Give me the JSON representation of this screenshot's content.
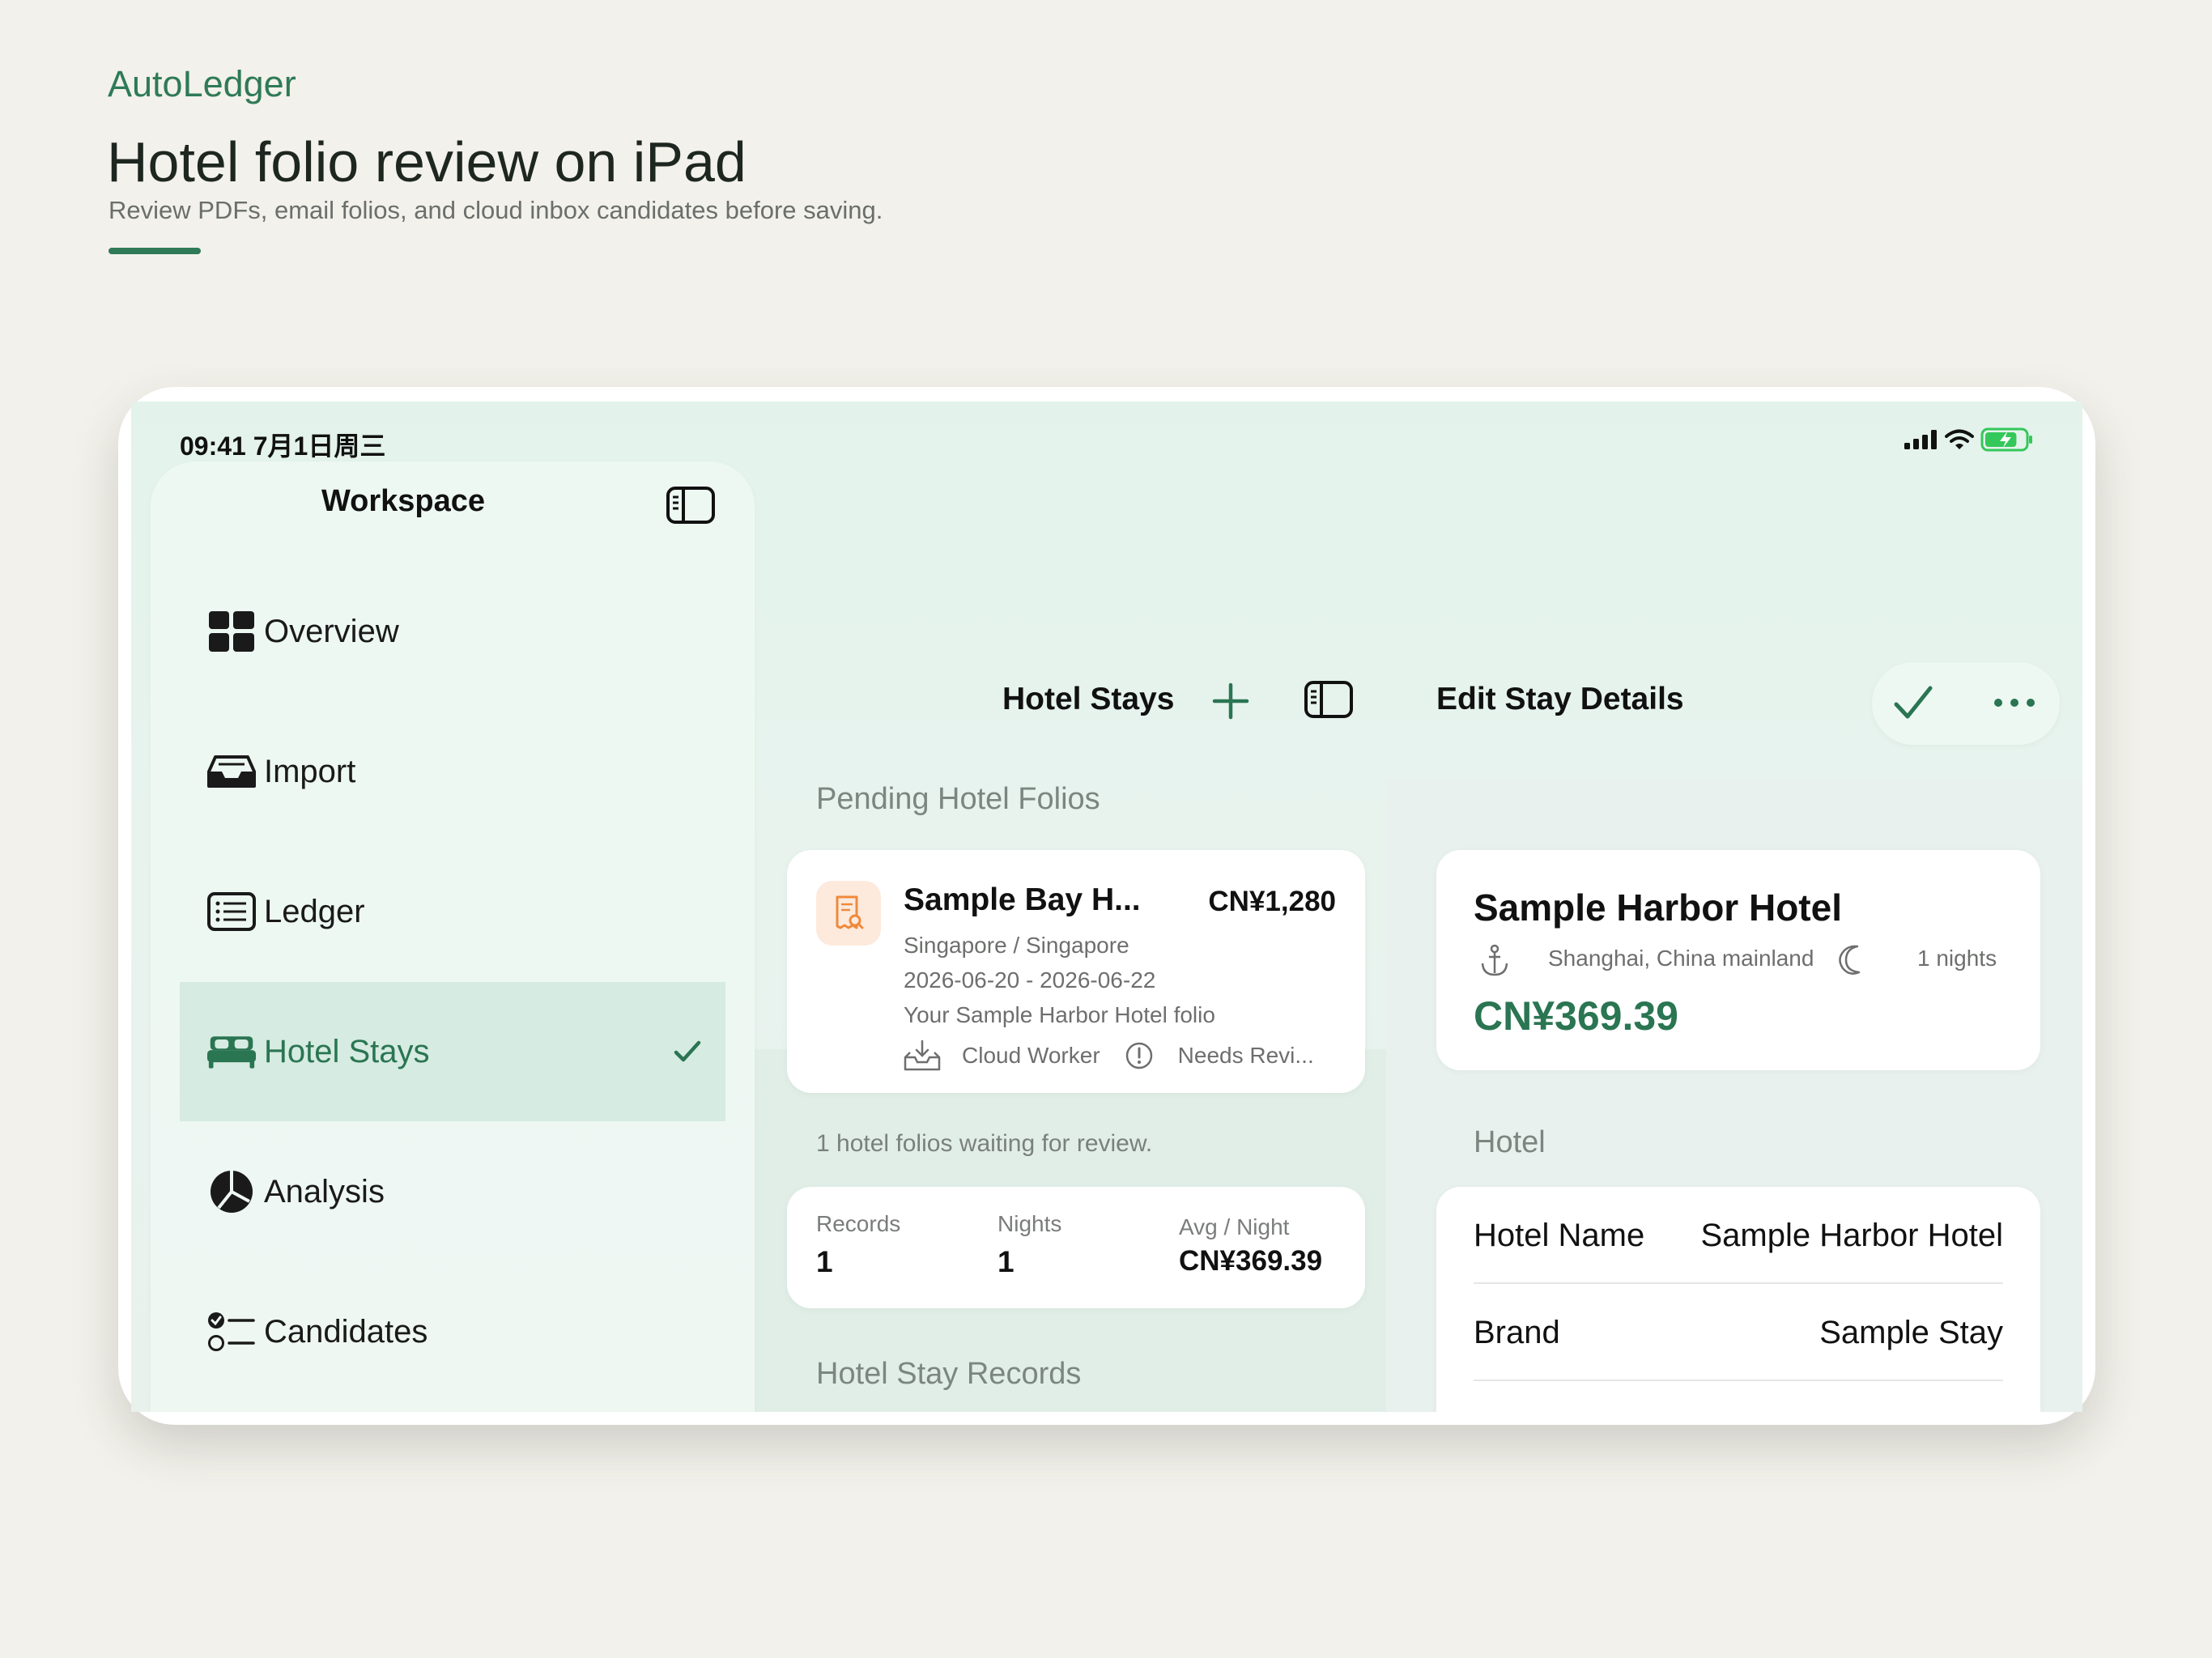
{
  "page": {
    "brand": "AutoLedger",
    "headline": "Hotel folio review on iPad",
    "subline": "Review PDFs, email folios, and cloud inbox candidates before saving."
  },
  "status_bar": {
    "time": "09:41  7月1日周三",
    "battery_level": 0.8
  },
  "colors": {
    "accent": "#2f7a57",
    "active_bg": "#d6ebe1",
    "folio_icon_bg": "#fdeadc",
    "folio_icon": "#ef8a3c"
  },
  "sidebar": {
    "title": "Workspace",
    "items": [
      {
        "label": "Overview",
        "icon": "grid-icon"
      },
      {
        "label": "Import",
        "icon": "inbox-tray-icon"
      },
      {
        "label": "Ledger",
        "icon": "list-icon"
      },
      {
        "label": "Hotel Stays",
        "icon": "bed-icon",
        "active": true
      },
      {
        "label": "Analysis",
        "icon": "pie-chart-icon"
      },
      {
        "label": "Candidates",
        "icon": "checklist-icon"
      }
    ]
  },
  "middle": {
    "title": "Hotel Stays",
    "pending_section": "Pending Hotel Folios",
    "folio": {
      "title": "Sample Bay H...",
      "amount": "CN¥1,280",
      "location": "Singapore / Singapore",
      "dates": "2026-06-20 - 2026-06-22",
      "subject": "Your Sample Harbor Hotel folio",
      "source": "Cloud Worker",
      "status": "Needs Revi..."
    },
    "waiting_note": "1 hotel folios waiting for review.",
    "stats": {
      "records_label": "Records",
      "records_value": "1",
      "nights_label": "Nights",
      "nights_value": "1",
      "avg_label": "Avg / Night",
      "avg_value": "CN¥369.39"
    },
    "records_section": "Hotel Stay Records"
  },
  "detail": {
    "title": "Edit Stay Details",
    "summary": {
      "hotel": "Sample Harbor Hotel",
      "location": "Shanghai, China mainland",
      "nights": "1 nights",
      "amount": "CN¥369.39"
    },
    "hotel_section": "Hotel",
    "rows": [
      {
        "key": "Hotel Name",
        "value": "Sample Harbor Hotel"
      },
      {
        "key": "Brand",
        "value": "Sample Stay"
      }
    ]
  }
}
